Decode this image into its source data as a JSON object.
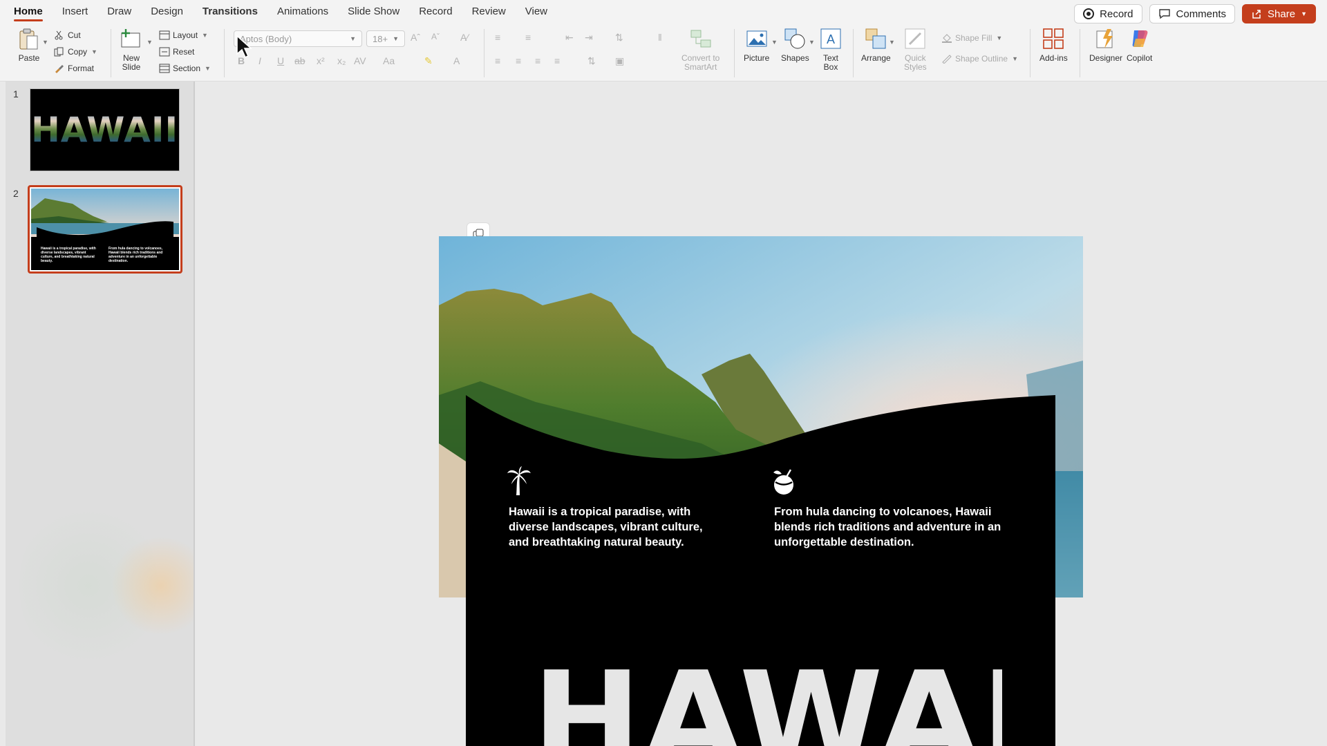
{
  "tabs": [
    "Home",
    "Insert",
    "Draw",
    "Design",
    "Transitions",
    "Animations",
    "Slide Show",
    "Record",
    "Review",
    "View"
  ],
  "top_actions": {
    "record": "Record",
    "comments": "Comments",
    "share": "Share"
  },
  "ribbon": {
    "paste": "Paste",
    "cut": "Cut",
    "copy": "Copy",
    "format": "Format",
    "new_slide_1": "New",
    "new_slide_2": "Slide",
    "layout": "Layout",
    "reset": "Reset",
    "section": "Section",
    "font_name": "Aptos (Body)",
    "font_size": "18+",
    "convert_1": "Convert to",
    "convert_2": "SmartArt",
    "picture": "Picture",
    "shapes": "Shapes",
    "textbox_1": "Text",
    "textbox_2": "Box",
    "arrange": "Arrange",
    "quick_1": "Quick",
    "quick_2": "Styles",
    "shape_fill": "Shape Fill",
    "shape_outline": "Shape Outline",
    "addins": "Add-ins",
    "designer": "Designer",
    "copilot": "Copilot"
  },
  "thumbnails": {
    "numbers": [
      "1",
      "2"
    ],
    "slide1_title": "HAWAII",
    "slide2_left": "Hawaii is a tropical paradise, with diverse landscapes, vibrant culture, and breathtaking natural beauty.",
    "slide2_right": "From hula dancing to volcanoes, Hawaii blends rich traditions and adventure in an unforgettable destination."
  },
  "slide": {
    "left_text": "Hawaii is a tropical paradise, with diverse landscapes, vibrant culture, and breathtaking natural beauty.",
    "right_text": "From hula dancing to volcanoes, Hawaii blends rich traditions and adventure in an unforgettable destination.",
    "big_title": "HAWAII",
    "left_icon": "palm-tree-icon",
    "right_icon": "coconut-drink-icon"
  },
  "colors": {
    "accent": "#c43e1c",
    "panel": "#000000",
    "sky": "#8fc3dc"
  }
}
